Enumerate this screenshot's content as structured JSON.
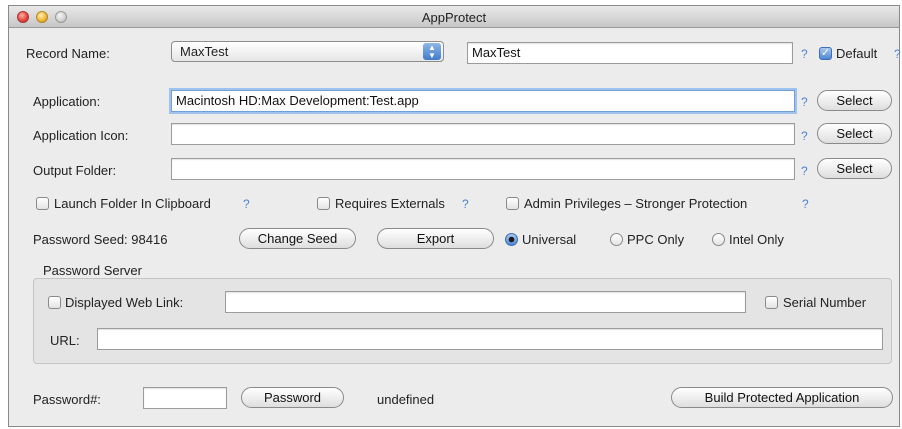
{
  "window": {
    "title": "AppProtect"
  },
  "record": {
    "label": "Record Name:",
    "popup_value": "MaxTest",
    "name_value": "MaxTest",
    "default_label": "Default",
    "default_checked": true
  },
  "application": {
    "label": "Application:",
    "value": "Macintosh HD:Max Development:Test.app",
    "select": "Select"
  },
  "app_icon": {
    "label": "Application Icon:",
    "value": "",
    "select": "Select"
  },
  "output": {
    "label": "Output Folder:",
    "value": "",
    "select": "Select"
  },
  "help_mark": "?",
  "options": {
    "launch_folder": "Launch Folder In Clipboard",
    "requires_externals": "Requires Externals",
    "admin_privileges": "Admin Privileges – Stronger Protection"
  },
  "seed": {
    "label": "Password Seed: 98416",
    "change_button": "Change Seed",
    "export_button": "Export",
    "radio_universal": "Universal",
    "radio_ppc": "PPC Only",
    "radio_intel": "Intel Only",
    "selected": "Universal"
  },
  "server": {
    "title": "Password Server",
    "web_link_label": "Displayed Web Link:",
    "web_link_value": "",
    "serial_label": "Serial Number",
    "url_label": "URL:",
    "url_value": ""
  },
  "password": {
    "label": "Password#:",
    "value": "",
    "button": "Password",
    "result": "undefined"
  },
  "build_button": "Build Protected Application"
}
